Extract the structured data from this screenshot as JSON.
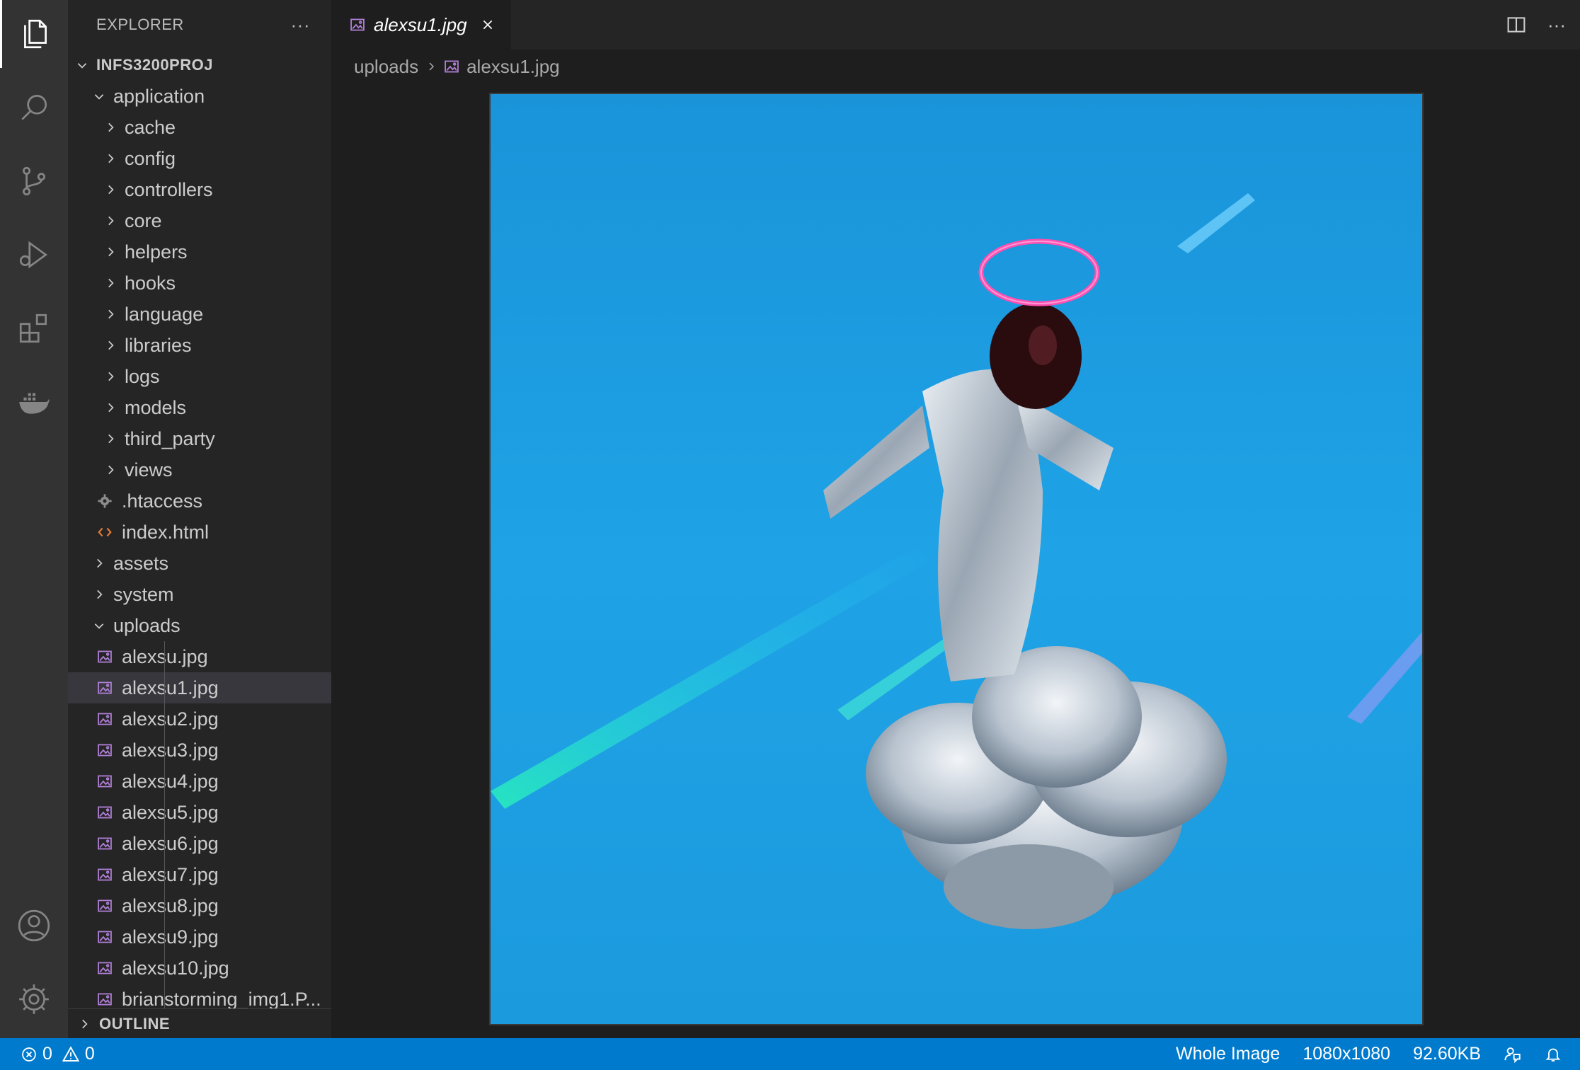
{
  "explorer": {
    "title": "EXPLORER",
    "more": "···",
    "root": "INFS3200PROJ",
    "items": [
      {
        "label": "application",
        "type": "folder-open",
        "depth": 1
      },
      {
        "label": "cache",
        "type": "folder",
        "depth": 2
      },
      {
        "label": "config",
        "type": "folder",
        "depth": 2
      },
      {
        "label": "controllers",
        "type": "folder",
        "depth": 2
      },
      {
        "label": "core",
        "type": "folder",
        "depth": 2
      },
      {
        "label": "helpers",
        "type": "folder",
        "depth": 2
      },
      {
        "label": "hooks",
        "type": "folder",
        "depth": 2
      },
      {
        "label": "language",
        "type": "folder",
        "depth": 2
      },
      {
        "label": "libraries",
        "type": "folder",
        "depth": 2
      },
      {
        "label": "logs",
        "type": "folder",
        "depth": 2
      },
      {
        "label": "models",
        "type": "folder",
        "depth": 2
      },
      {
        "label": "third_party",
        "type": "folder",
        "depth": 2
      },
      {
        "label": "views",
        "type": "folder",
        "depth": 2
      },
      {
        "label": ".htaccess",
        "type": "gear-file",
        "depth": 2
      },
      {
        "label": "index.html",
        "type": "html-file",
        "depth": 2
      },
      {
        "label": "assets",
        "type": "folder",
        "depth": 1
      },
      {
        "label": "system",
        "type": "folder",
        "depth": 1
      },
      {
        "label": "uploads",
        "type": "folder-open",
        "depth": 1
      },
      {
        "label": "alexsu.jpg",
        "type": "image-file",
        "depth": 2
      },
      {
        "label": "alexsu1.jpg",
        "type": "image-file",
        "depth": 2,
        "selected": true
      },
      {
        "label": "alexsu2.jpg",
        "type": "image-file",
        "depth": 2
      },
      {
        "label": "alexsu3.jpg",
        "type": "image-file",
        "depth": 2
      },
      {
        "label": "alexsu4.jpg",
        "type": "image-file",
        "depth": 2
      },
      {
        "label": "alexsu5.jpg",
        "type": "image-file",
        "depth": 2
      },
      {
        "label": "alexsu6.jpg",
        "type": "image-file",
        "depth": 2
      },
      {
        "label": "alexsu7.jpg",
        "type": "image-file",
        "depth": 2
      },
      {
        "label": "alexsu8.jpg",
        "type": "image-file",
        "depth": 2
      },
      {
        "label": "alexsu9.jpg",
        "type": "image-file",
        "depth": 2
      },
      {
        "label": "alexsu10.jpg",
        "type": "image-file",
        "depth": 2
      },
      {
        "label": "brianstorming_img1.P...",
        "type": "image-file",
        "depth": 2
      }
    ],
    "outline": "OUTLINE"
  },
  "tab": {
    "label": "alexsu1.jpg",
    "icon": "image-file-icon"
  },
  "breadcrumb": {
    "folder": "uploads",
    "file": "alexsu1.jpg"
  },
  "image": {
    "description_icon": "astronaut-image"
  },
  "status": {
    "errors": "0",
    "warnings": "0",
    "zoom": "Whole Image",
    "dimensions": "1080x1080",
    "size": "92.60KB"
  },
  "colors": {
    "accent": "#007acc",
    "image_icon": "#b180d7",
    "html_icon": "#e37933"
  }
}
